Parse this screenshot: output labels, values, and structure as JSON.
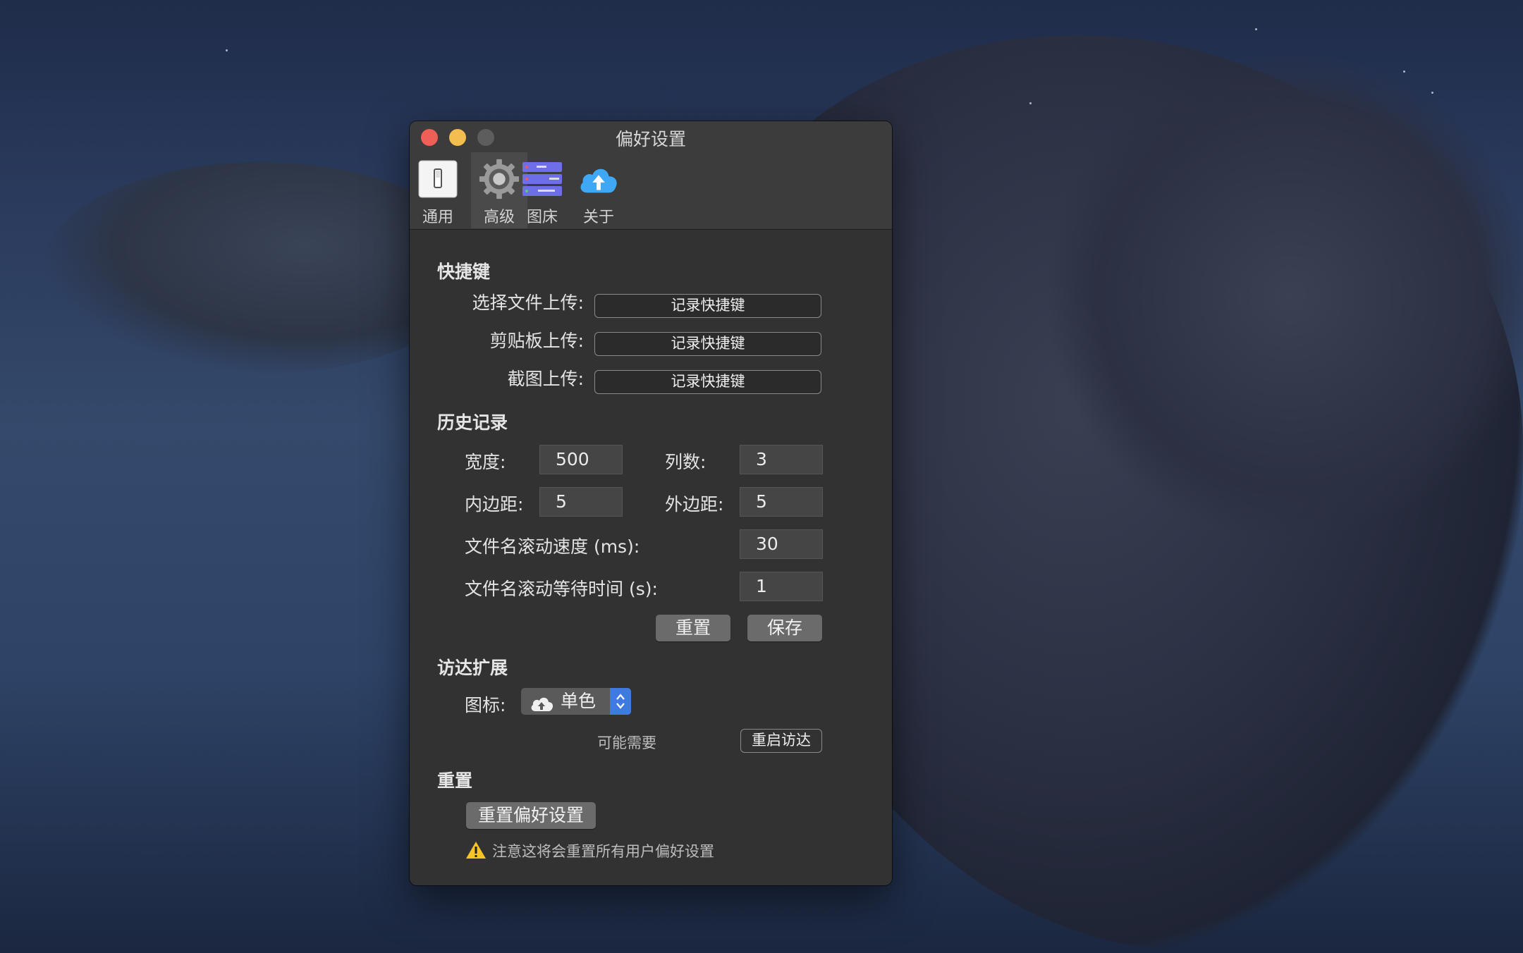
{
  "window": {
    "title": "偏好设置",
    "tabs": [
      {
        "label": "通用",
        "icon": "switch-icon"
      },
      {
        "label": "高级",
        "icon": "gear-icon"
      },
      {
        "label": "图床",
        "icon": "server-icon"
      },
      {
        "label": "关于",
        "icon": "cloud-upload-icon"
      }
    ],
    "selected_tab": "高级"
  },
  "shortcuts": {
    "heading": "快捷键",
    "rows": [
      {
        "label": "选择文件上传:",
        "button": "记录快捷键"
      },
      {
        "label": "剪贴板上传:",
        "button": "记录快捷键"
      },
      {
        "label": "截图上传:",
        "button": "记录快捷键"
      }
    ]
  },
  "history": {
    "heading": "历史记录",
    "width_label": "宽度:",
    "width_value": "500",
    "columns_label": "列数:",
    "columns_value": "3",
    "inner_padding_label": "内边距:",
    "inner_padding_value": "5",
    "outer_padding_label": "外边距:",
    "outer_padding_value": "5",
    "scroll_speed_label": "文件名滚动速度 (ms):",
    "scroll_speed_value": "30",
    "scroll_wait_label": "文件名滚动等待时间 (s):",
    "scroll_wait_value": "1",
    "reset_button": "重置",
    "save_button": "保存"
  },
  "finder": {
    "heading": "访达扩展",
    "icon_label": "图标:",
    "icon_value": "单色",
    "hint": "可能需要",
    "restart_button": "重启访达"
  },
  "reset": {
    "heading": "重置",
    "button": "重置偏好设置",
    "warning": "注意这将会重置所有用户偏好设置"
  },
  "colors": {
    "close": "#ee5f57",
    "minimize": "#f4bd4f",
    "accent": "#3f7ae0",
    "warning": "#f6c427"
  }
}
